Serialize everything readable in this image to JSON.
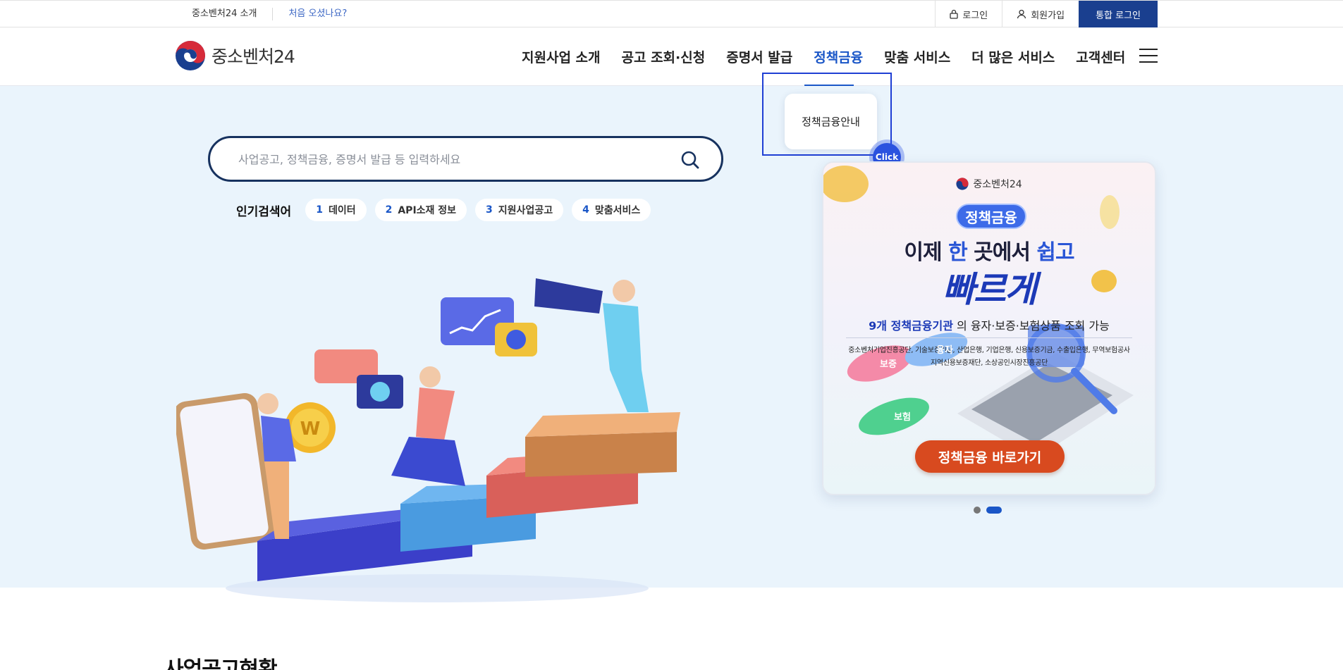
{
  "util": {
    "about": "중소벤처24 소개",
    "first_visit": "처음 오셨나요?",
    "login": "로그인",
    "signup": "회원가입",
    "integrated_login": "통합 로그인"
  },
  "logo": {
    "text": "중소벤처24"
  },
  "nav": {
    "items": [
      "지원사업 소개",
      "공고 조회·신청",
      "증명서 발급",
      "정책금융",
      "맞춤 서비스",
      "더 많은 서비스",
      "고객센터"
    ],
    "active_index": 3
  },
  "search": {
    "placeholder": "사업공고, 정책금융, 증명서 발급 등 입력하세요"
  },
  "popular": {
    "title": "인기검색어",
    "items": [
      {
        "num": "1",
        "label": "데이터"
      },
      {
        "num": "2",
        "label": "API소재 정보"
      },
      {
        "num": "3",
        "label": "지원사업공고"
      },
      {
        "num": "4",
        "label": "맞춤서비스"
      }
    ]
  },
  "dropdown": {
    "item": "정책금융안내"
  },
  "click_badge": {
    "label": "Click"
  },
  "banner": {
    "logo_text": "중소벤처24",
    "pill": "정책금융",
    "line1_a": "이제 ",
    "line1_hl1": "한",
    "line1_b": " 곳에서 ",
    "line1_hl2": "쉽고",
    "line2": "빠르게",
    "line3_hl": "9개 정책금융기관",
    "line3_rest": "의 융자·보증·보험상품 조회 가능",
    "orgs_1": "중소벤처기업진흥공단, 기술보증기금, 산업은행, 기업은행, 신용보증기금, 수출입은행, 무역보험공사",
    "orgs_2": "지역신용보증재단, 소상공인시장진흥공단",
    "bubble_1": "보증",
    "bubble_2": "융자",
    "bubble_3": "보험",
    "button": "정책금융 바로가기"
  },
  "carousel": {
    "count": 2,
    "active": 2
  },
  "section": {
    "title": "사업공고현황"
  },
  "colors": {
    "primary": "#1a3f8f",
    "accent": "#1a56c7",
    "hero_bg": "#eaf4fc",
    "cta": "#d84a1f"
  }
}
